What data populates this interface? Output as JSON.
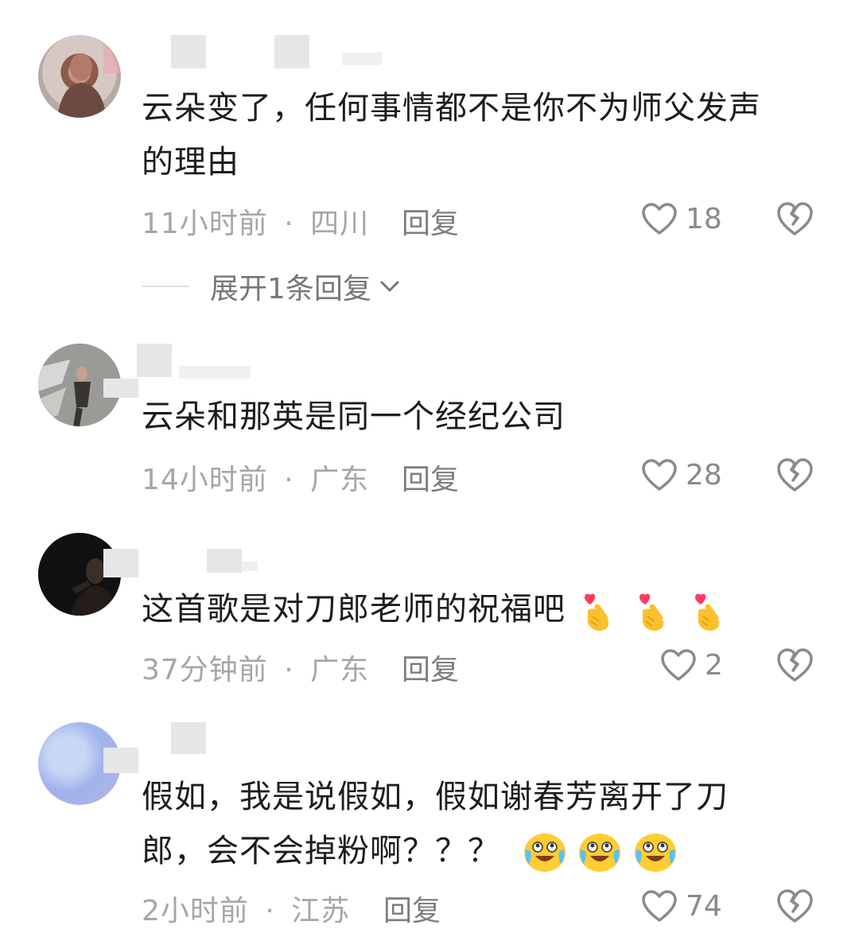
{
  "comments": [
    {
      "text_lines": [
        "云朵变了，任何事情都不是你不为师父发声",
        "的理由"
      ],
      "time": "11小时前",
      "location": "四川",
      "reply_label": "回复",
      "likes": "18",
      "expand_label": "展开1条回复"
    },
    {
      "text": "云朵和那英是同一个经纪公司",
      "time": "14小时前",
      "location": "广东",
      "reply_label": "回复",
      "likes": "28"
    },
    {
      "text": "这首歌是对刀郎老师的祝福吧",
      "emojis": [
        "finger-heart-emoji",
        "finger-heart-emoji",
        "finger-heart-emoji"
      ],
      "time": "37分钟前",
      "location": "广东",
      "reply_label": "回复",
      "likes": "2"
    },
    {
      "text_lines": [
        "假如，我是说假如，假如谢春芳离开了刀",
        "郎，会不会掉粉啊？？？"
      ],
      "emojis": [
        "crying-laughing-emoji",
        "crying-laughing-emoji",
        "crying-laughing-emoji"
      ],
      "time": "2小时前",
      "location": "江苏",
      "reply_label": "回复",
      "likes": "74"
    }
  ],
  "separator": "·",
  "colors": {
    "text": "#1d1d1d",
    "meta": "#a6a6a6",
    "icon": "#8a8a8a"
  },
  "icons": [
    "heart-outline-icon",
    "broken-heart-icon",
    "chevron-down-icon"
  ]
}
